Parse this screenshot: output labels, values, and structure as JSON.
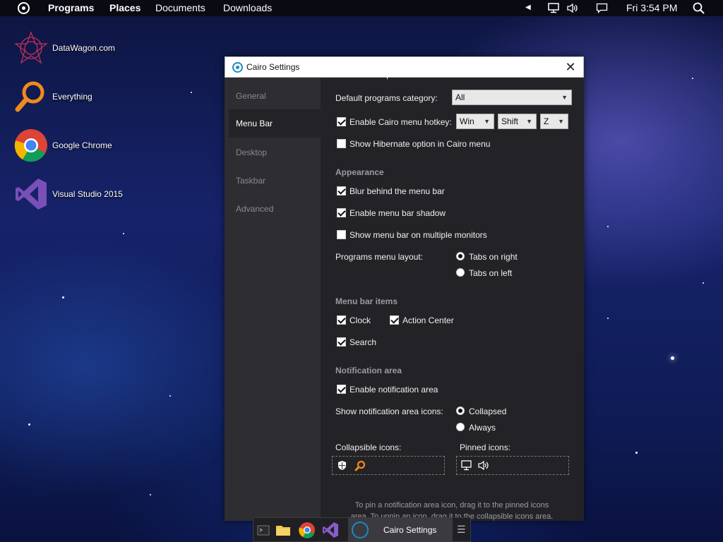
{
  "menubar": {
    "items": [
      "Programs",
      "Places",
      "Documents",
      "Downloads"
    ],
    "clock": "Fri 3:54 PM",
    "icons": [
      "back-arrow-icon",
      "network-icon",
      "volume-icon",
      "action-center-icon",
      "search-icon"
    ]
  },
  "desktop": {
    "icons": [
      {
        "label": "DataWagon.com",
        "icon": "datawagon-icon"
      },
      {
        "label": "Everything",
        "icon": "everything-search-icon"
      },
      {
        "label": "Google Chrome",
        "icon": "chrome-icon"
      },
      {
        "label": "Visual Studio 2015",
        "icon": "visual-studio-icon"
      }
    ]
  },
  "window": {
    "title": "Cairo Settings",
    "sidebar": [
      "General",
      "Menu Bar",
      "Desktop",
      "Taskbar",
      "Advanced"
    ],
    "active_tab": "Menu Bar",
    "content": {
      "default_programs_label": "Default programs category:",
      "default_programs_value": "All",
      "hotkey_label": "Enable Cairo menu hotkey:",
      "hotkey_checked": true,
      "hotkey_mod1": "Win",
      "hotkey_mod2": "Shift",
      "hotkey_key": "Z",
      "hibernate_label": "Show Hibernate option in Cairo menu",
      "hibernate_checked": false,
      "appearance_header": "Appearance",
      "blur_label": "Blur behind the menu bar",
      "shadow_label": "Enable menu bar shadow",
      "multi_monitor_label": "Show menu bar on multiple monitors",
      "layout_label": "Programs menu layout:",
      "layout_right": "Tabs on right",
      "layout_left": "Tabs on left",
      "menu_items_header": "Menu bar items",
      "clock_label": "Clock",
      "action_center_label": "Action Center",
      "search_label": "Search",
      "notification_header": "Notification area",
      "enable_notif_label": "Enable notification area",
      "notif_icons_label": "Show notification area icons:",
      "collapsed_label": "Collapsed",
      "always_label": "Always",
      "collapsible_label": "Collapsible icons:",
      "pinned_label": "Pinned icons:",
      "hint": "To pin a notification area icon, drag it to the pinned icons area. To unpin an icon, drag it to the collapsible icons area."
    }
  },
  "taskbar": {
    "active_label": "Cairo Settings",
    "apps": [
      "terminal-icon",
      "file-explorer-icon",
      "chrome-icon",
      "visual-studio-icon",
      "cairo-icon"
    ]
  }
}
